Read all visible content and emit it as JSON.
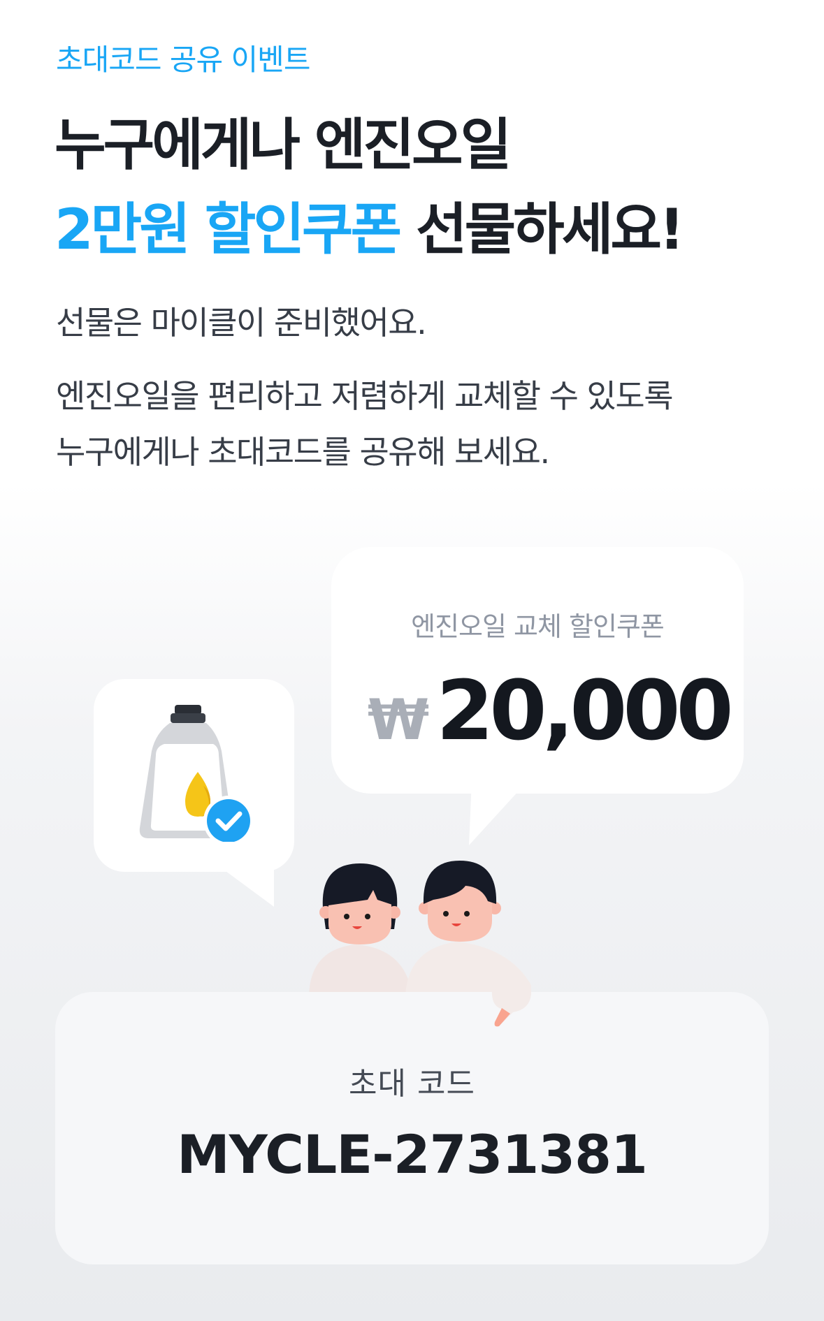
{
  "header": {
    "eyebrow": "초대코드 공유 이벤트",
    "headline_line1": "누구에게나 엔진오일",
    "headline_line2_highlight": "2만원 할인쿠폰",
    "headline_line2_rest": " 선물하세요!"
  },
  "description": {
    "line1": "선물은 마이클이 준비했어요.",
    "line2": "엔진오일을 편리하고 저렴하게 교체할 수 있도록",
    "line3": "누구에게나 초대코드를 공유해 보세요."
  },
  "coupon": {
    "label": "엔진오일 교체 할인쿠폰",
    "currency_symbol": "₩",
    "amount": "20,000"
  },
  "invite_code": {
    "label": "초대 코드",
    "code": "MYCLE-2731381"
  },
  "icons": {
    "oil": "engine-oil-bottle-icon",
    "check": "check-circle-icon",
    "people": "two-people-illustration"
  },
  "colors": {
    "accent": "#19a6f5",
    "text_primary": "#1b1f26",
    "text_secondary": "#373d47",
    "muted": "#8f96a3",
    "oil_drop": "#f5c518"
  }
}
